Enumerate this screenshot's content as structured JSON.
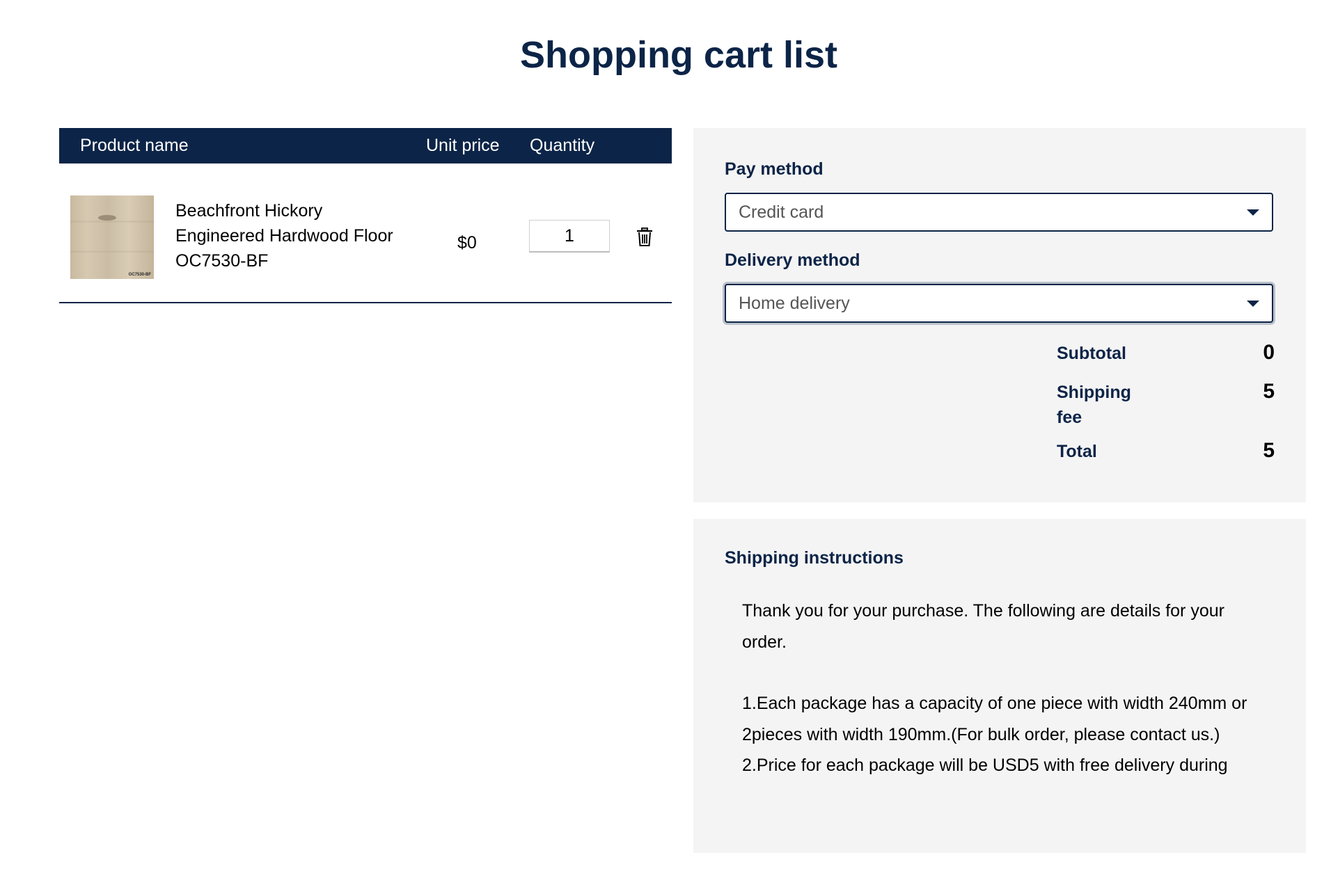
{
  "page": {
    "title": "Shopping cart list"
  },
  "cart": {
    "headers": {
      "product_name": "Product name",
      "unit_price": "Unit price",
      "quantity": "Quantity"
    },
    "items": [
      {
        "name": "Beachfront Hickory Engineered Hardwood Floor OC7530-BF",
        "image_label": "OC7530-BF",
        "unit_price": "$0",
        "quantity": "1",
        "delete_icon": "trash-icon"
      }
    ]
  },
  "summary": {
    "pay_method_label": "Pay method",
    "pay_method_value": "Credit card",
    "delivery_method_label": "Delivery method",
    "delivery_method_value": "Home delivery",
    "subtotal_label": "Subtotal",
    "subtotal_value": "0",
    "shipping_fee_label": "Shipping fee",
    "shipping_fee_value": "5",
    "total_label": "Total",
    "total_value": "5"
  },
  "instructions": {
    "title": "Shipping instructions",
    "intro": "Thank you for your purchase. The following are details for your order.",
    "line1": "1.Each package has a capacity of one piece with width 240mm or 2pieces with width 190mm.(For bulk order, please contact us.)",
    "line2": "2.Price for each package will be USD5 with free delivery during"
  },
  "colors": {
    "primary": "#0c2447",
    "panel_bg": "#f4f4f4"
  }
}
